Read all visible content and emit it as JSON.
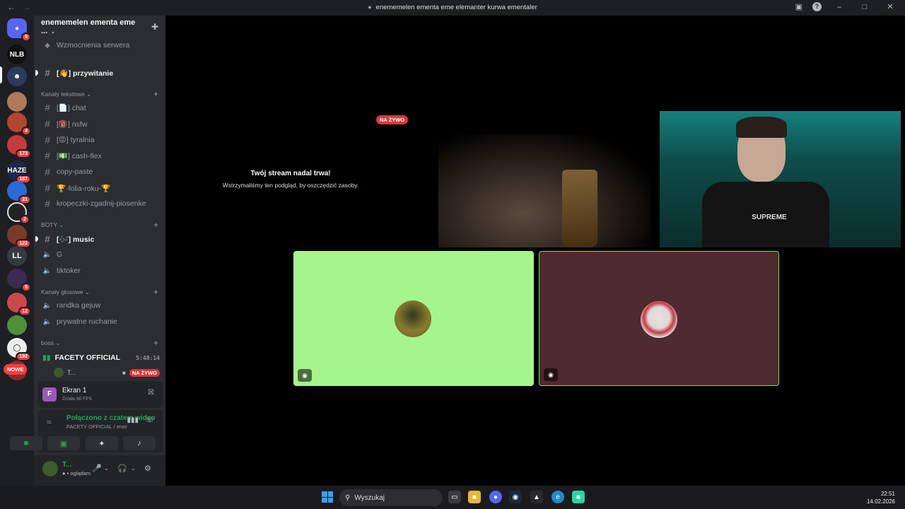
{
  "window": {
    "title": "enememelen ementa eme elemanter kurwa ementaler"
  },
  "rail": {
    "badges": [
      "9",
      "4",
      "173",
      "187",
      "21",
      "2",
      "122",
      "5",
      "12",
      "192"
    ],
    "text_server": "LL",
    "new_pill": "NOWE"
  },
  "server": {
    "name": "enememelen ementa eme ...",
    "boosts": "Wzmocnienia serwera"
  },
  "channels": {
    "welcome": "[👋] przywitanie",
    "cat_text": "Kanały tekstowe",
    "chat": "[📄] chat",
    "nsfw": "[🔞] nsfw",
    "tyralnia": "[😡] tyralnia",
    "cashflex": "[💵] cash-flex",
    "copypaste": "copy-paste",
    "folia": "🏆-folia-roku-🏆",
    "kropeczki": "kropeczki-zgadnij-piosenke",
    "cat_bots": "BOTY",
    "music": "[🎶] music",
    "g": "G",
    "tiktoker": "tiktoker",
    "cat_voice": "Kanały głosowe",
    "randka": "randka gejuw",
    "prywatne": "prywatne ruchanie",
    "cat_boss": "boss",
    "facety": "FACETY OFFICIAL",
    "facety_timer": "5:48:14",
    "voice_user": "T...",
    "live": "NA ŻYWO"
  },
  "screen_share": {
    "title": "Ekran 1",
    "source": "Źródło 60 FPS",
    "letter": "F"
  },
  "connection": {
    "status": "Połączono z czatem wideo",
    "location": "FACETY OFFICIAL / enememelen e..."
  },
  "user": {
    "name": "T...",
    "status": "oglądam"
  },
  "stage": {
    "live": "NA ŻYWO",
    "heading": "Twój stream nadal trwa!",
    "subtext": "Wstrzymaliśmy ten podgląd, by oszczędzić zasoby.",
    "shirt_print": "SUPREME"
  },
  "taskbar": {
    "search": "Wyszukaj",
    "time": "22:51",
    "date": "14.02.2026"
  }
}
